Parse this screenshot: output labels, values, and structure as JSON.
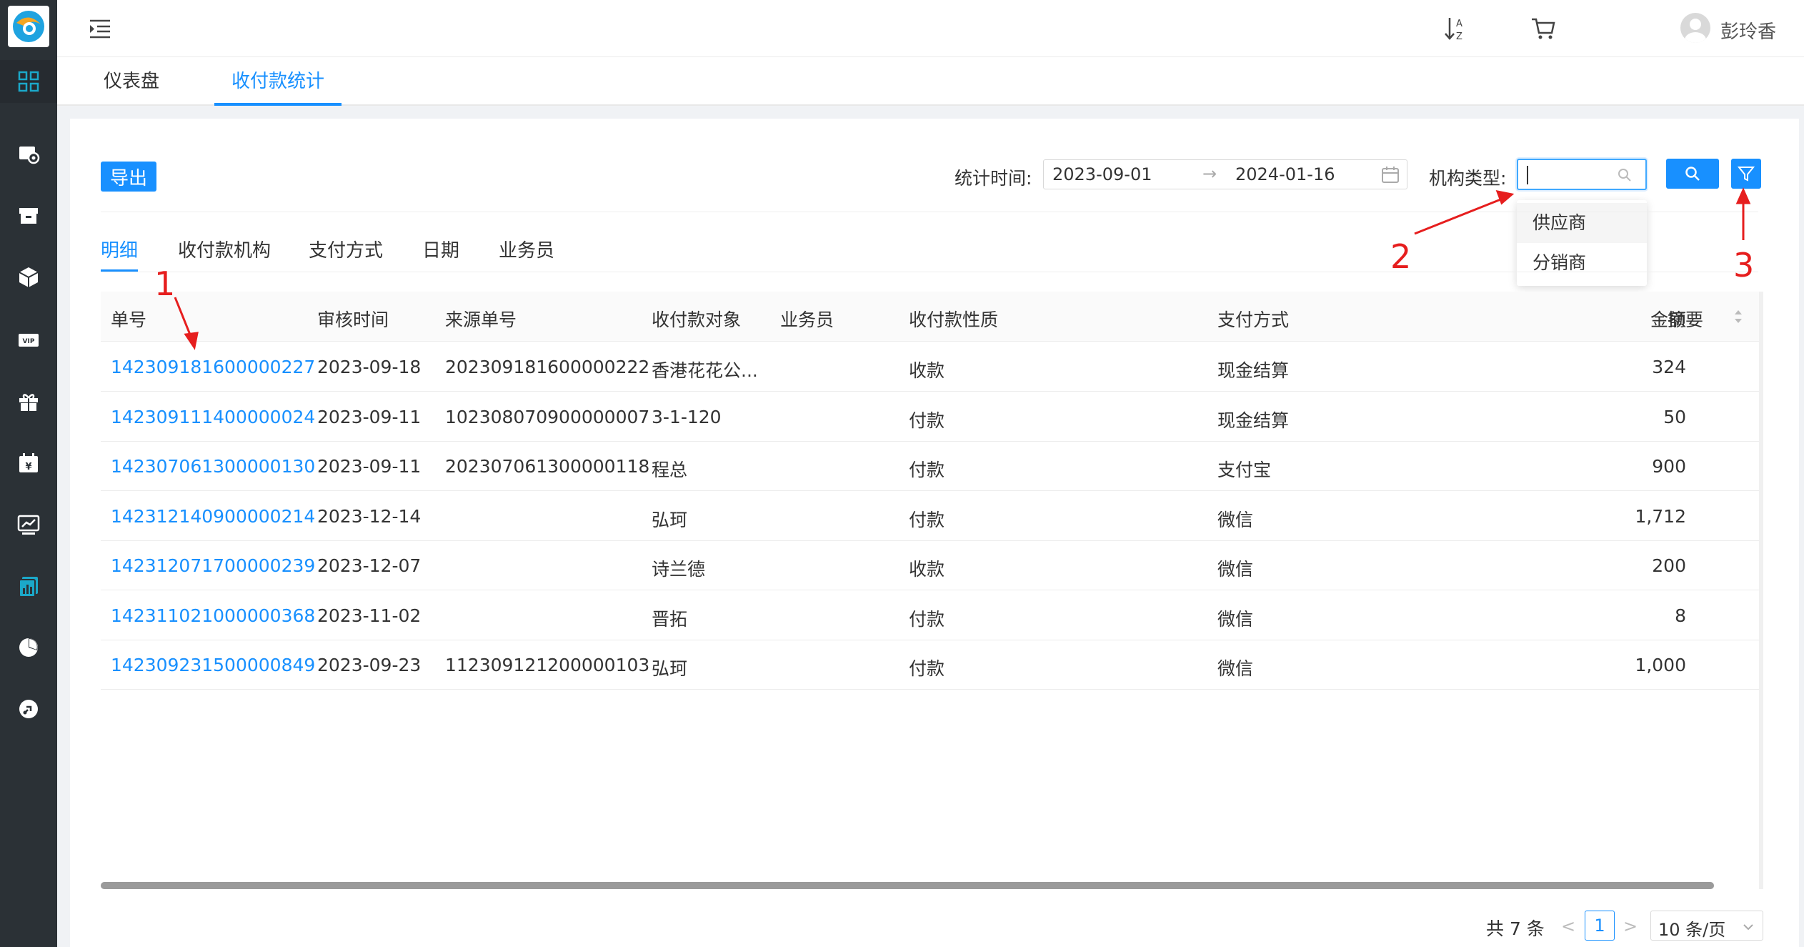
{
  "header": {
    "username": "彭玲香"
  },
  "tabs": [
    {
      "label": "仪表盘",
      "active": false
    },
    {
      "label": "收付款统计",
      "active": true
    }
  ],
  "toolbar": {
    "export_label": "导出",
    "stat_time_label": "统计时间:",
    "date_start": "2023-09-01",
    "date_arrow": "→",
    "date_end": "2024-01-16",
    "org_type_label": "机构类型:",
    "org_type_value": ""
  },
  "org_dropdown": {
    "options": [
      "供应商",
      "分销商"
    ],
    "hovered_index": 0
  },
  "sub_tabs": [
    {
      "label": "明细",
      "active": true
    },
    {
      "label": "收付款机构",
      "active": false
    },
    {
      "label": "支付方式",
      "active": false
    },
    {
      "label": "日期",
      "active": false
    },
    {
      "label": "业务员",
      "active": false
    }
  ],
  "table": {
    "columns": [
      "单号",
      "审核时间",
      "来源单号",
      "收付款对象",
      "业务员",
      "收付款性质",
      "支付方式",
      "金额",
      "摘要"
    ],
    "rows": [
      {
        "no": "142309181600000227",
        "audit_time": "2023-09-18",
        "source_no": "202309181600000222",
        "target": "香港花花公...",
        "salesman": "",
        "nature": "收款",
        "pay_method": "现金结算",
        "amount": "324",
        "summary": ""
      },
      {
        "no": "142309111400000024",
        "audit_time": "2023-09-11",
        "source_no": "102308070900000007",
        "target": "3-1-120",
        "salesman": "",
        "nature": "付款",
        "pay_method": "现金结算",
        "amount": "50",
        "summary": ""
      },
      {
        "no": "142307061300000130",
        "audit_time": "2023-09-11",
        "source_no": "202307061300000118",
        "target": "程总",
        "salesman": "",
        "nature": "付款",
        "pay_method": "支付宝",
        "amount": "900",
        "summary": ""
      },
      {
        "no": "142312140900000214",
        "audit_time": "2023-12-14",
        "source_no": "",
        "target": "弘珂",
        "salesman": "",
        "nature": "付款",
        "pay_method": "微信",
        "amount": "1,712",
        "summary": ""
      },
      {
        "no": "142312071700000239",
        "audit_time": "2023-12-07",
        "source_no": "",
        "target": "诗兰德",
        "salesman": "",
        "nature": "收款",
        "pay_method": "微信",
        "amount": "200",
        "summary": ""
      },
      {
        "no": "142311021000000368",
        "audit_time": "2023-11-02",
        "source_no": "",
        "target": "晋拓",
        "salesman": "",
        "nature": "付款",
        "pay_method": "微信",
        "amount": "8",
        "summary": ""
      },
      {
        "no": "142309231500000849",
        "audit_time": "2023-09-23",
        "source_no": "112309121200000103",
        "target": "弘珂",
        "salesman": "",
        "nature": "付款",
        "pay_method": "微信",
        "amount": "1,000",
        "summary": ""
      }
    ]
  },
  "pagination": {
    "total_text": "共 7 条",
    "prev": "<",
    "current_page": "1",
    "next": ">",
    "page_size": "10 条/页"
  },
  "annotations": {
    "label_1": "1",
    "label_2": "2",
    "label_3": "3",
    "color": "#e61e1e"
  },
  "colors": {
    "primary": "#1890ff",
    "sidebar_bg": "#2b3136",
    "sidebar_active_icon": "#1ba8c9"
  },
  "sidebar_icons": [
    "app-logo-icon",
    "dashboard-grid-icon",
    "settings-monitor-icon",
    "archive-box-icon",
    "cube-icon",
    "vip-card-icon",
    "gift-icon",
    "finance-calendar-icon",
    "trend-chart-icon",
    "report-stats-icon",
    "pie-chart-icon",
    "link-circle-icon"
  ]
}
